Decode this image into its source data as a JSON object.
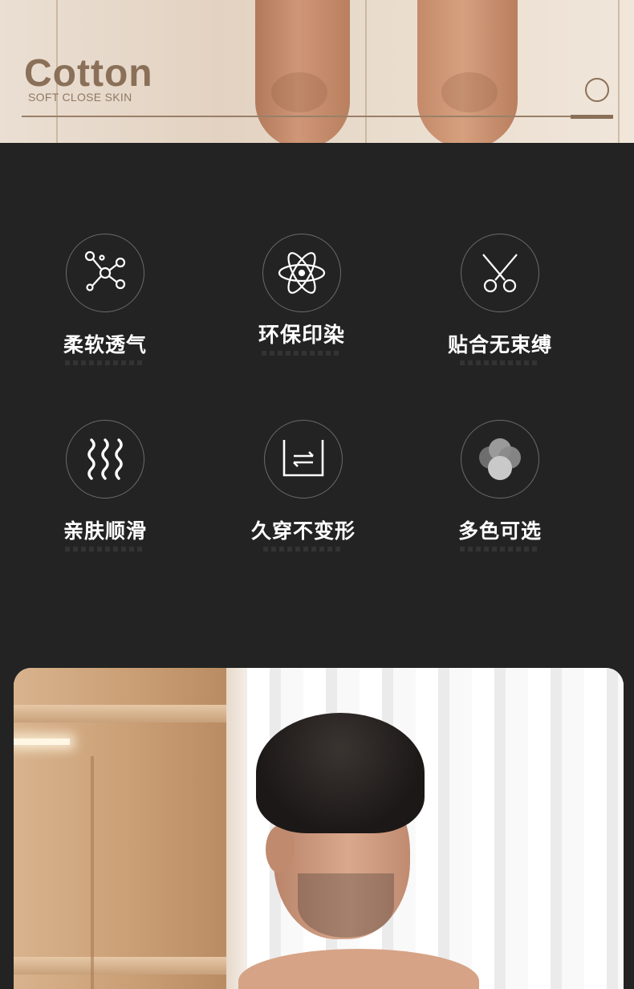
{
  "banner": {
    "title": "Cotton",
    "subtitle": "SOFT CLOSE SKIN"
  },
  "features": [
    {
      "label": "柔软透气",
      "icon": "molecule-icon"
    },
    {
      "label": "环保印染",
      "icon": "atom-icon"
    },
    {
      "label": "贴合无束缚",
      "icon": "scissors-icon"
    },
    {
      "label": "亲肤顺滑",
      "icon": "waves-icon"
    },
    {
      "label": "久穿不变形",
      "icon": "shrink-resistant-icon"
    },
    {
      "label": "多色可选",
      "icon": "color-dots-icon"
    }
  ],
  "colors": {
    "background": "#232323",
    "banner_text": "#8a7058",
    "icon_stroke": "#ffffff",
    "circle_border": "#6b6b6b"
  }
}
